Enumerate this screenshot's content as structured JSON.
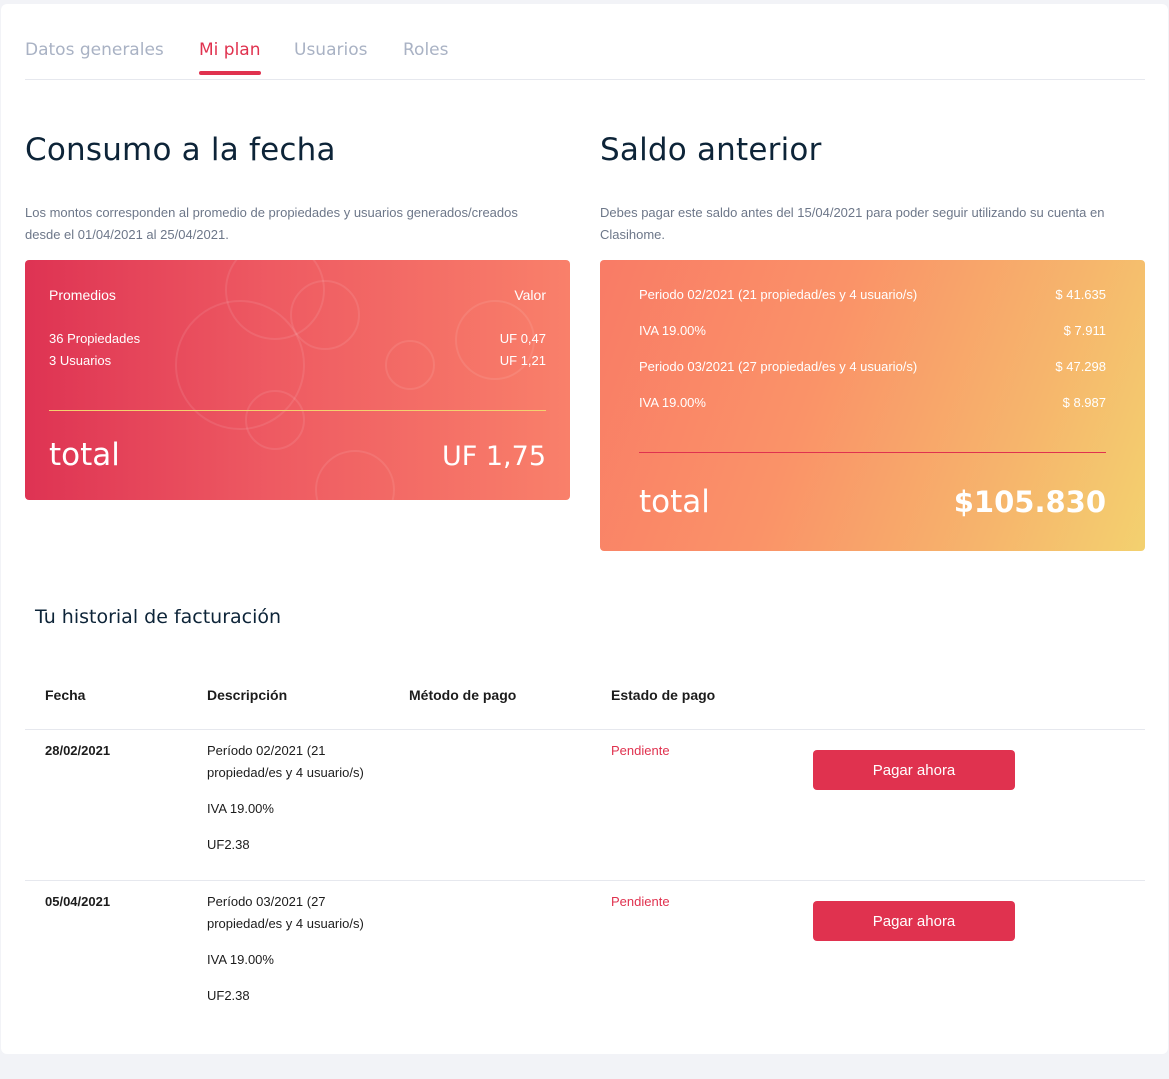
{
  "tabs": [
    {
      "label": "Datos generales",
      "active": false
    },
    {
      "label": "Mi plan",
      "active": true
    },
    {
      "label": "Usuarios",
      "active": false
    },
    {
      "label": "Roles",
      "active": false
    }
  ],
  "consumo": {
    "title": "Consumo a la fecha",
    "description": "Los montos corresponden al promedio de propiedades y usuarios generados/creados desde el 01/04/2021 al 25/04/2021.",
    "header_left": "Promedios",
    "header_right": "Valor",
    "rows": [
      {
        "label": "36 Propiedades",
        "value": "UF 0,47"
      },
      {
        "label": "3 Usuarios",
        "value": "UF 1,21"
      }
    ],
    "total_label": "total",
    "total_value": "UF 1,75"
  },
  "saldo": {
    "title": "Saldo anterior",
    "description": "Debes pagar este saldo antes del 15/04/2021 para poder seguir utilizando su cuenta en Clasihome.",
    "rows": [
      {
        "label": "Periodo 02/2021 (21 propiedad/es y 4 usuario/s)",
        "value": "$ 41.635"
      },
      {
        "label": "IVA 19.00%",
        "value": "$ 7.911"
      },
      {
        "label": "Periodo 03/2021 (27 propiedad/es y 4 usuario/s)",
        "value": "$ 47.298"
      },
      {
        "label": "IVA 19.00%",
        "value": "$ 8.987"
      }
    ],
    "total_label": "total",
    "total_value": "$105.830"
  },
  "history": {
    "title": "Tu historial de facturación",
    "columns": [
      "Fecha",
      "Descripción",
      "Método de pago",
      "Estado de pago"
    ],
    "rows": [
      {
        "date": "28/02/2021",
        "description": "Período 02/2021 (21 propiedad/es y 4 usuario/s)",
        "iva": "IVA 19.00%",
        "amount": "UF2.38",
        "payment_method": "",
        "status": "Pendiente",
        "action": "Pagar ahora"
      },
      {
        "date": "05/04/2021",
        "description": "Período 03/2021 (27 propiedad/es y 4 usuario/s)",
        "iva": "IVA 19.00%",
        "amount": "UF2.38",
        "payment_method": "",
        "status": "Pendiente",
        "action": "Pagar ahora"
      }
    ]
  },
  "colors": {
    "accent": "#e0324f",
    "text_dark": "#0d2438",
    "tab_inactive": "#a9b2c4"
  }
}
